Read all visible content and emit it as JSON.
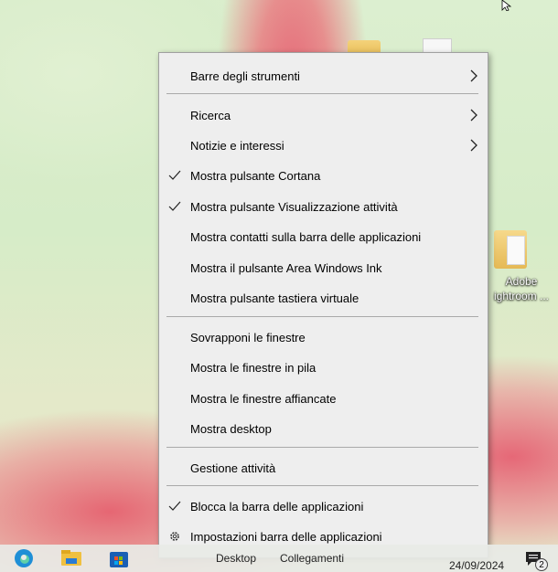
{
  "context_menu": {
    "items": [
      {
        "label": "Barre degli strumenti"
      },
      {
        "label": "Ricerca"
      },
      {
        "label": "Notizie e interessi"
      },
      {
        "label": "Mostra pulsante Cortana"
      },
      {
        "label": "Mostra pulsante Visualizzazione attività"
      },
      {
        "label": "Mostra contatti sulla barra delle applicazioni"
      },
      {
        "label": "Mostra il pulsante Area Windows Ink"
      },
      {
        "label": "Mostra pulsante tastiera virtuale"
      },
      {
        "label": "Sovrapponi le finestre"
      },
      {
        "label": "Mostra le finestre in pila"
      },
      {
        "label": "Mostra le finestre affiancate"
      },
      {
        "label": "Mostra desktop"
      },
      {
        "label": "Gestione attività"
      },
      {
        "label": "Blocca la barra delle applicazioni"
      },
      {
        "label": "Impostazioni barra delle applicazioni"
      }
    ]
  },
  "desktop": {
    "icon_label": "Adobe\nightroom ..."
  },
  "taskbar": {
    "desktop_label": "Desktop",
    "links_label": "Collegamenti",
    "date": "24/09/2024",
    "notification_count": "2",
    "icons": [
      "edge-icon",
      "file-explorer-icon",
      "store-icon"
    ]
  },
  "colors": {
    "menu_bg": "#eeeeee",
    "separator": "#a9a9a9"
  }
}
